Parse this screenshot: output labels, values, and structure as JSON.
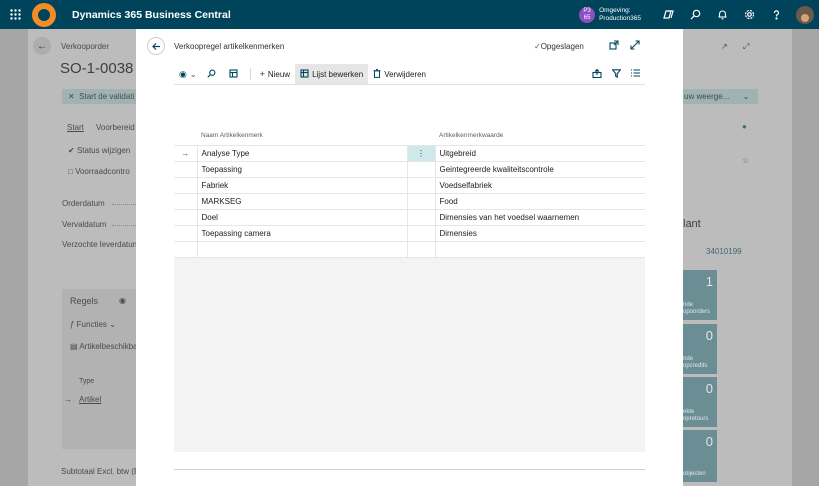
{
  "app": {
    "title": "Dynamics 365 Business Central"
  },
  "environment": {
    "badge_line1": "P3",
    "badge_line2": "65",
    "label": "Omgeving:",
    "value": "Production365"
  },
  "background": {
    "section_label": "Verkooporder",
    "title": "SO-1-0038",
    "banner_text": "Start de validati",
    "banner_right": "uw weerge...",
    "tab_start": "Start",
    "tab_prepare": "Voorbereid",
    "action_status": "Status wijzigen",
    "action_stock": "Voorraadcontro",
    "field_orderdate": "Orderdatum",
    "field_duedate": "Vervaldatum",
    "field_requested": "Verzochte leverdatum",
    "right_heading": "lant",
    "right_number": "34010199",
    "lines_label": "Regels",
    "functions_label": "Functies",
    "item_avail_label": "Artikelbeschikba",
    "col_type": "Type",
    "row_type": "Artikel",
    "subtotal": "Subtotaal Excl. btw (E",
    "tiles": [
      {
        "num": "1",
        "line1": "nde",
        "line2": "opoorders"
      },
      {
        "num": "0",
        "line1": "nde",
        "line2": "opcredits"
      },
      {
        "num": "0",
        "line1": "ekte",
        "line2": "opretours"
      },
      {
        "num": "0",
        "line1": "",
        "line2": "objecten"
      }
    ]
  },
  "dialog": {
    "title": "Verkoopregel artikelkenmerken",
    "saved_label": "Opgeslagen",
    "toolbar": {
      "new_label": "Nieuw",
      "edit_list_label": "Lijst bewerken",
      "delete_label": "Verwijderen"
    },
    "columns": {
      "name": "Naam Artikelkenmerk",
      "value": "Artikelkenmerkwaarde"
    },
    "rows": [
      {
        "name": "Analyse Type",
        "value": "Uitgebreid"
      },
      {
        "name": "Toepassing",
        "value": "Geintegreerde kwaliteitscontrole"
      },
      {
        "name": "Fabriek",
        "value": "Voedselfabriek"
      },
      {
        "name": "MARKSEG",
        "value": "Food"
      },
      {
        "name": "Doel",
        "value": "Dimensies van het voedsel waarnemen"
      },
      {
        "name": "Toepassing camera",
        "value": "Dimensies"
      },
      {
        "name": "",
        "value": ""
      }
    ]
  },
  "colors": {
    "topbar": "#00445c",
    "accent": "#00445c",
    "logo": "#f28c28",
    "selected_cell": "#cfe8ea"
  },
  "icons": [
    "waffle-icon",
    "copilot-icon",
    "search-icon",
    "bell-icon",
    "gear-icon",
    "help-icon",
    "back-arrow-icon",
    "checkmark-icon",
    "popout-icon",
    "expand-icon",
    "filter-icon",
    "share-icon",
    "list-icon",
    "trash-icon",
    "plus-icon",
    "row-arrow-icon",
    "more-vertical-icon"
  ]
}
